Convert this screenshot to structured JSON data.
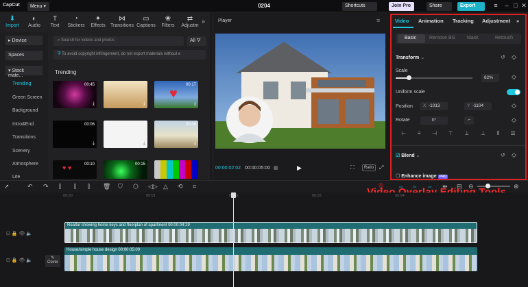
{
  "titlebar": {
    "logo": "CapCut",
    "menu": "Menu ▾",
    "project_title": "0204",
    "shortcuts": "Shortcuts",
    "join_pro": "Join Pro",
    "share": "Share",
    "export": "Export"
  },
  "tools": [
    {
      "label": "Import",
      "icon": "import-icon"
    },
    {
      "label": "Audio",
      "icon": "audio-icon"
    },
    {
      "label": "Text",
      "icon": "text-icon"
    },
    {
      "label": "Stickers",
      "icon": "stickers-icon"
    },
    {
      "label": "Effects",
      "icon": "effects-icon"
    },
    {
      "label": "Transitions",
      "icon": "transitions-icon"
    },
    {
      "label": "Captions",
      "icon": "captions-icon"
    },
    {
      "label": "Filters",
      "icon": "filters-icon"
    },
    {
      "label": "Adjustm",
      "icon": "adjustment-icon"
    }
  ],
  "leftnav": {
    "device": "▸ Device",
    "spaces": "Spaces",
    "stock": "▾ Stock mate...",
    "items": [
      "Trending",
      "Green Screen",
      "Background",
      "Intro&End",
      "Transitions",
      "Scenery",
      "Atmosphere",
      "Life"
    ]
  },
  "media": {
    "search_placeholder": "Search for videos and photos",
    "all": "All",
    "notice": "To avoid copyright infringement, do not export materials without e",
    "section": "Trending",
    "durations": [
      "00:45",
      "",
      "00:17",
      "00:06",
      "",
      "00:06",
      "00:10",
      "00:15",
      ""
    ]
  },
  "player": {
    "label": "Player",
    "time_current": "00:00:02:02",
    "time_total": "00:00:05:00",
    "ratio": "Ratio"
  },
  "inspector": {
    "tabs": [
      "Video",
      "Animation",
      "Tracking",
      "Adjustment"
    ],
    "subtabs": [
      "Basic",
      "Remove BG",
      "Mask",
      "Retouch"
    ],
    "transform": "Transform",
    "scale_label": "Scale",
    "scale_value": "82%",
    "scale_fraction": 0.82,
    "uniform_scale": "Uniform scale",
    "position_label": "Position",
    "pos_x_label": "X",
    "pos_x": "-1013",
    "pos_y_label": "Y",
    "pos_y": "-1104",
    "rotate_label": "Rotate",
    "rotate_value": "0°",
    "blend": "Blend",
    "enhance": "Enhance image",
    "pro_badge": "PRO"
  },
  "annotation": "Video Overlay Editing Tools",
  "timeline": {
    "ticks": [
      "00:00",
      "00:01",
      "00:02",
      "00:03",
      "00:04"
    ],
    "clip1": "Realtor showing home keys and floorplan of apartment  00:00:04:29",
    "clip2": "House/simple house design  00:00:05:00",
    "cover": "Cover"
  },
  "colors": {
    "accent": "#1ec8e0",
    "annotation": "#e02020",
    "export": "#1eb2c9"
  }
}
